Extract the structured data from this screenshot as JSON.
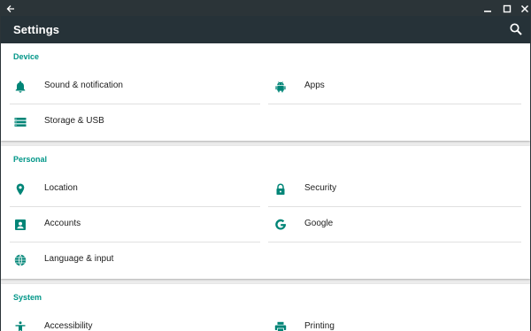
{
  "window": {
    "title_icons": [
      "back-arrow-icon",
      "minimize-icon",
      "maximize-icon",
      "close-icon"
    ]
  },
  "appbar": {
    "title": "Settings",
    "search_icon": "search-icon"
  },
  "colors": {
    "titlebar": "#2b3438",
    "appbar": "#263238",
    "accent": "#009688",
    "icon": "#008577"
  },
  "sections": {
    "device": {
      "title": "Device",
      "items": [
        {
          "label": "Sound & notification",
          "icon": "bell-icon"
        },
        {
          "label": "Apps",
          "icon": "android-icon"
        },
        {
          "label": "Storage & USB",
          "icon": "storage-icon"
        }
      ]
    },
    "personal": {
      "title": "Personal",
      "items": [
        {
          "label": "Location",
          "icon": "location-pin-icon"
        },
        {
          "label": "Security",
          "icon": "lock-icon"
        },
        {
          "label": "Accounts",
          "icon": "account-box-icon"
        },
        {
          "label": "Google",
          "icon": "google-icon"
        },
        {
          "label": "Language & input",
          "icon": "globe-icon"
        }
      ]
    },
    "system": {
      "title": "System",
      "items": [
        {
          "label": "Accessibility",
          "icon": "accessibility-icon"
        },
        {
          "label": "Printing",
          "icon": "printer-icon"
        }
      ]
    }
  }
}
